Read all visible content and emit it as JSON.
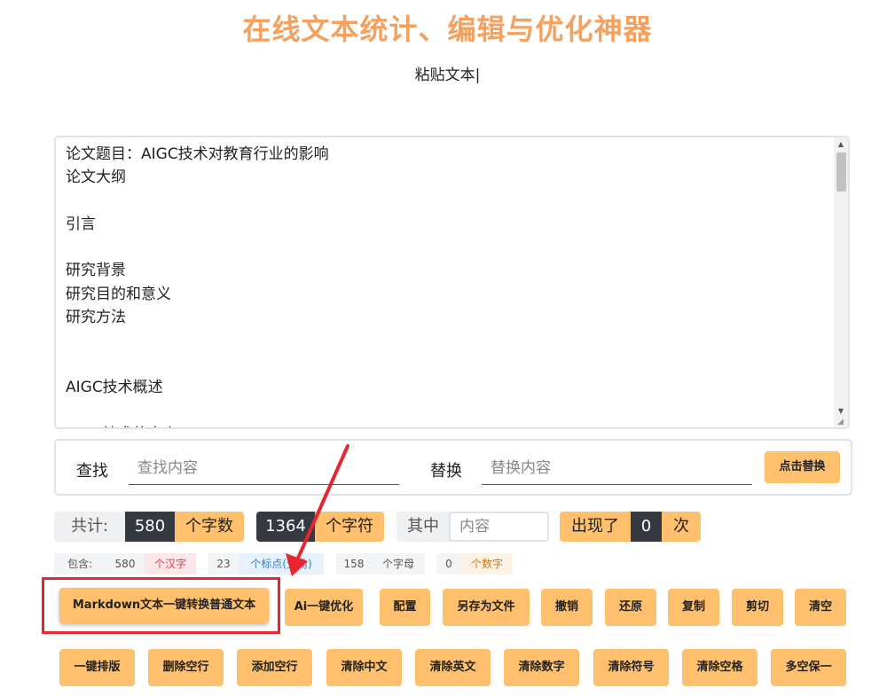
{
  "page": {
    "title": "在线文本统计、编辑与优化神器",
    "subtitle": "粘贴文本",
    "caret": "|"
  },
  "editor": {
    "lines": [
      "论文题目：AIGC技术对教育行业的影响",
      "论文大纲",
      "",
      "引言",
      "",
      "研究背景",
      "研究目的和意义",
      "研究方法",
      "",
      "",
      "AIGC技术概述",
      "",
      "AIGC技术的定义"
    ]
  },
  "find": {
    "find_label": "查找",
    "find_placeholder": "查找内容",
    "replace_label": "替换",
    "replace_placeholder": "替换内容",
    "replace_button": "点击替换"
  },
  "stats": {
    "total_label": "共计:",
    "char_count": "580",
    "char_count_unit": "个字数",
    "symbol_count": "1364",
    "symbol_count_unit": "个字符",
    "among_label": "其中",
    "search_placeholder": "内容",
    "appeared_label": "出现了",
    "appeared_count": "0",
    "times_unit": "次"
  },
  "contains": {
    "label": "包含:",
    "chinese_count": "580",
    "chinese_unit": "个汉字",
    "punct_count": "23",
    "punct_unit": "个标点(全角)",
    "letter_count": "158",
    "letter_unit": "个字母",
    "digit_count": "0",
    "digit_unit": "个数字"
  },
  "buttons": {
    "row1": [
      "Markdown文本一键转换普通文本",
      "Ai一键优化",
      "配置",
      "另存为文件",
      "撤销",
      "还原",
      "复制",
      "剪切",
      "清空"
    ],
    "row2": [
      "一键排版",
      "删除空行",
      "添加空行",
      "清除中文",
      "清除英文",
      "清除数字",
      "清除符号",
      "清除空格",
      "多空保一"
    ]
  },
  "colors": {
    "title": "#f5a05d",
    "button": "#ffc06e",
    "dark_badge": "#343a40",
    "annotation_red": "#e8242e"
  }
}
